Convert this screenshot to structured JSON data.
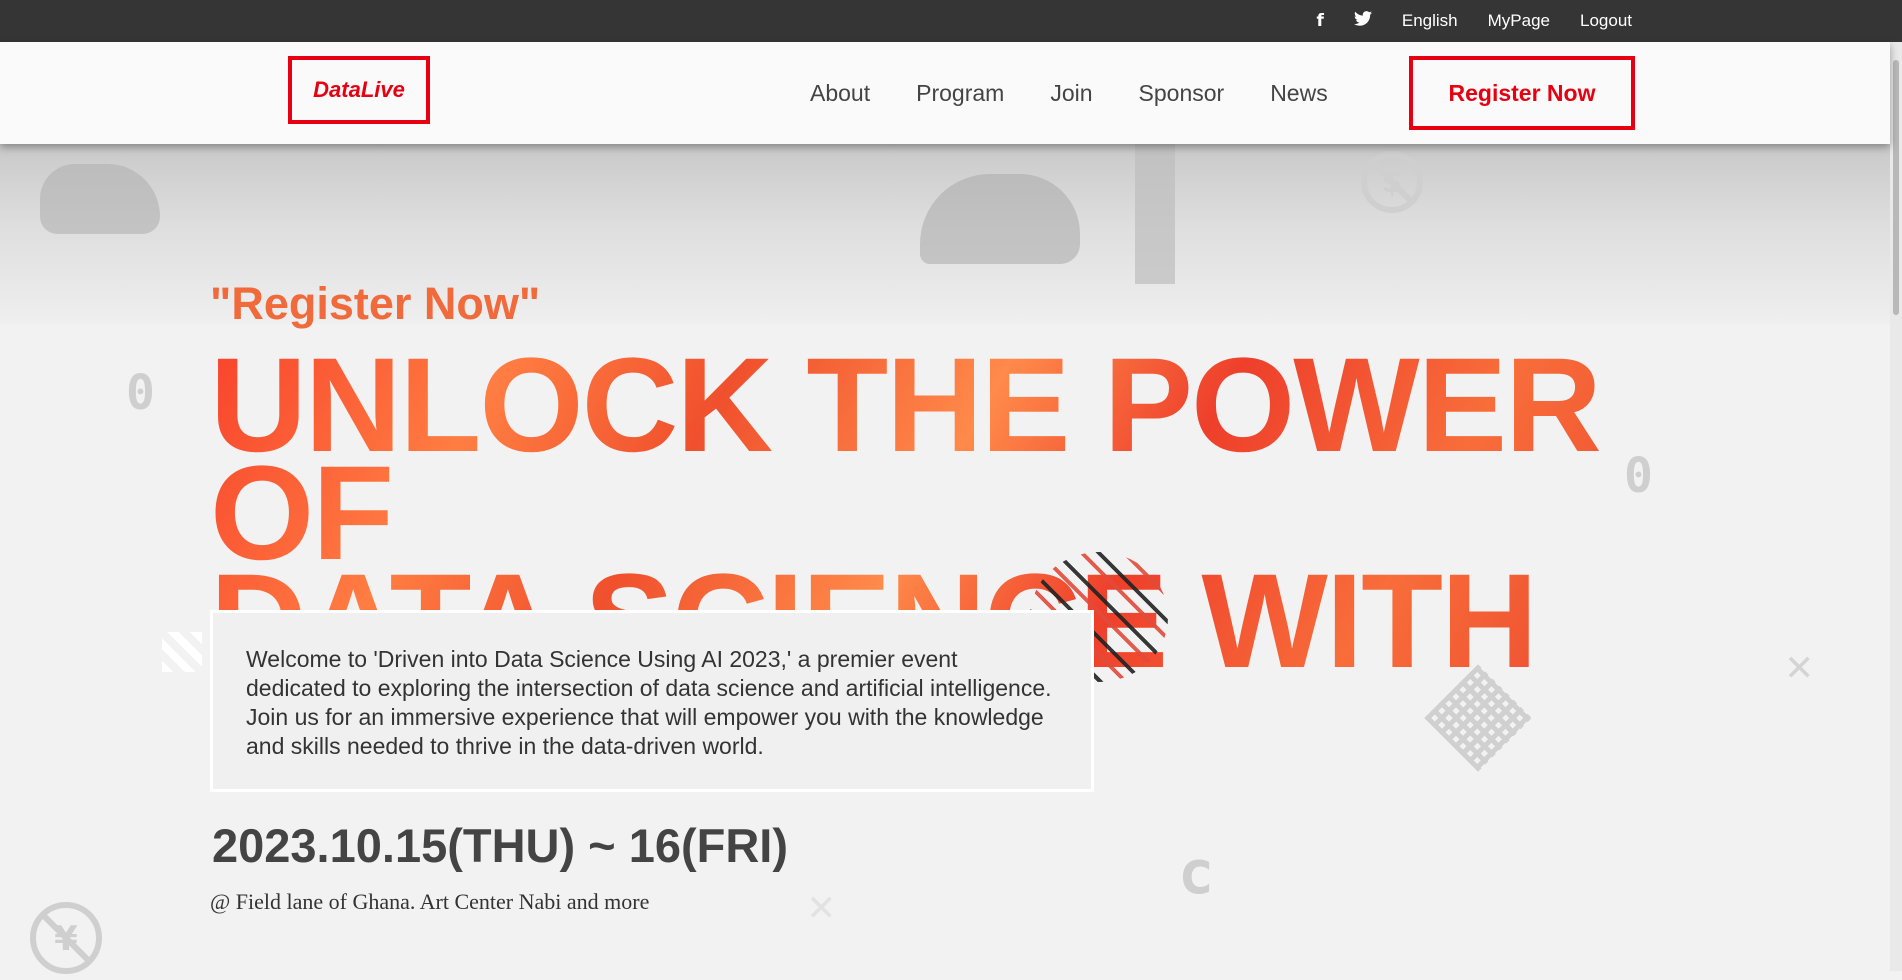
{
  "topbar": {
    "facebook_icon": "f",
    "twitter_icon": "t",
    "language": "English",
    "mypage": "MyPage",
    "logout": "Logout"
  },
  "header": {
    "logo": "DataLive",
    "nav": [
      "About",
      "Program",
      "Join",
      "Sponsor",
      "News"
    ],
    "register_button": "Register Now"
  },
  "hero": {
    "subtitle": "\"Register Now\"",
    "headline_line1": "UNLOCK THE POWER OF",
    "headline_line2": "DATA SCIENCE WITH AI",
    "description": "Welcome to 'Driven into Data Science Using AI 2023,' a premier event dedicated to exploring the intersection of data science and artificial intelligence. Join us for an immersive experience that will empower you with the knowledge and skills needed to thrive in the data-driven world.",
    "date": "2023.10.15(THU) ~ 16(FRI)",
    "venue": "@ Field lane of Ghana. Art Center Nabi and more"
  },
  "decorations": {
    "zero_left": "0",
    "zero_right": "0",
    "c_letter": "c",
    "dollar_icon": "$",
    "yen_icon": "¥",
    "x_icon": "✕"
  },
  "colors": {
    "accent": "#e60012",
    "topbar_bg": "#353535",
    "subtitle": "#f06a3c"
  }
}
